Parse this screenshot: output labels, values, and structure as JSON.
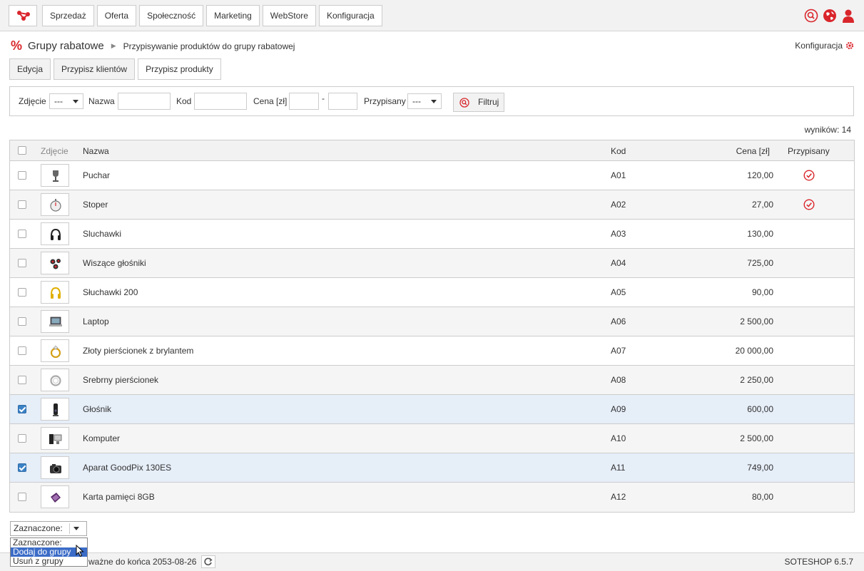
{
  "nav": [
    "Sprzedaż",
    "Oferta",
    "Społeczność",
    "Marketing",
    "WebStore",
    "Konfiguracja"
  ],
  "breadcrumb": {
    "title": "Grupy rabatowe",
    "sub": "Przypisywanie produktów do grupy rabatowej"
  },
  "config_link": "Konfiguracja",
  "tabs": [
    "Edycja",
    "Przypisz klientów",
    "Przypisz produkty"
  ],
  "filter": {
    "zdjecie_label": "Zdjęcie",
    "zdjecie_value": "---",
    "nazwa_label": "Nazwa",
    "kod_label": "Kod",
    "cena_label": "Cena [zł]",
    "cena_sep": "-",
    "przypisany_label": "Przypisany",
    "przypisany_value": "---",
    "button": "Filtruj"
  },
  "results": "wyników: 14",
  "table": {
    "headers": {
      "zdjecie": "Zdjęcie",
      "nazwa": "Nazwa",
      "kod": "Kod",
      "cena": "Cena [zł]",
      "przypisany": "Przypisany"
    },
    "rows": [
      {
        "name": "Puchar",
        "code": "A01",
        "price": "120,00",
        "assigned": true,
        "checked": false,
        "icon": "trophy-icon"
      },
      {
        "name": "Stoper",
        "code": "A02",
        "price": "27,00",
        "assigned": true,
        "checked": false,
        "icon": "stopwatch-icon"
      },
      {
        "name": "Sluchawki",
        "code": "A03",
        "price": "130,00",
        "assigned": false,
        "checked": false,
        "icon": "headphones-icon"
      },
      {
        "name": "Wiszące głośniki",
        "code": "A04",
        "price": "725,00",
        "assigned": false,
        "checked": false,
        "icon": "speakers-icon"
      },
      {
        "name": "Słuchawki 200",
        "code": "A05",
        "price": "90,00",
        "assigned": false,
        "checked": false,
        "icon": "headphones-yellow-icon"
      },
      {
        "name": "Laptop",
        "code": "A06",
        "price": "2 500,00",
        "assigned": false,
        "checked": false,
        "icon": "laptop-icon"
      },
      {
        "name": "Złoty pierścionek z brylantem",
        "code": "A07",
        "price": "20 000,00",
        "assigned": false,
        "checked": false,
        "icon": "gold-ring-icon"
      },
      {
        "name": "Srebrny pierścionek",
        "code": "A08",
        "price": "2 250,00",
        "assigned": false,
        "checked": false,
        "icon": "silver-ring-icon"
      },
      {
        "name": "Głośnik",
        "code": "A09",
        "price": "600,00",
        "assigned": false,
        "checked": true,
        "icon": "speaker-icon"
      },
      {
        "name": "Komputer",
        "code": "A10",
        "price": "2 500,00",
        "assigned": false,
        "checked": false,
        "icon": "computer-icon"
      },
      {
        "name": "Aparat GoodPix 130ES",
        "code": "A11",
        "price": "749,00",
        "assigned": false,
        "checked": true,
        "icon": "camera-icon"
      },
      {
        "name": "Karta pamięci 8GB",
        "code": "A12",
        "price": "80,00",
        "assigned": false,
        "checked": false,
        "icon": "memory-card-icon"
      }
    ]
  },
  "bulk": {
    "label": "Zaznaczone:",
    "options": [
      "Zaznaczone:",
      "Dodaj do grupy",
      "Usuń z grupy"
    ],
    "highlighted": 1
  },
  "footer": {
    "license": "ważne do końca 2053-08-26",
    "version": "SOTESHOP 6.5.7"
  },
  "colors": {
    "accent": "#d9262c",
    "selected_row": "#e6eef8",
    "menu_highlight": "#3b6cc7"
  }
}
